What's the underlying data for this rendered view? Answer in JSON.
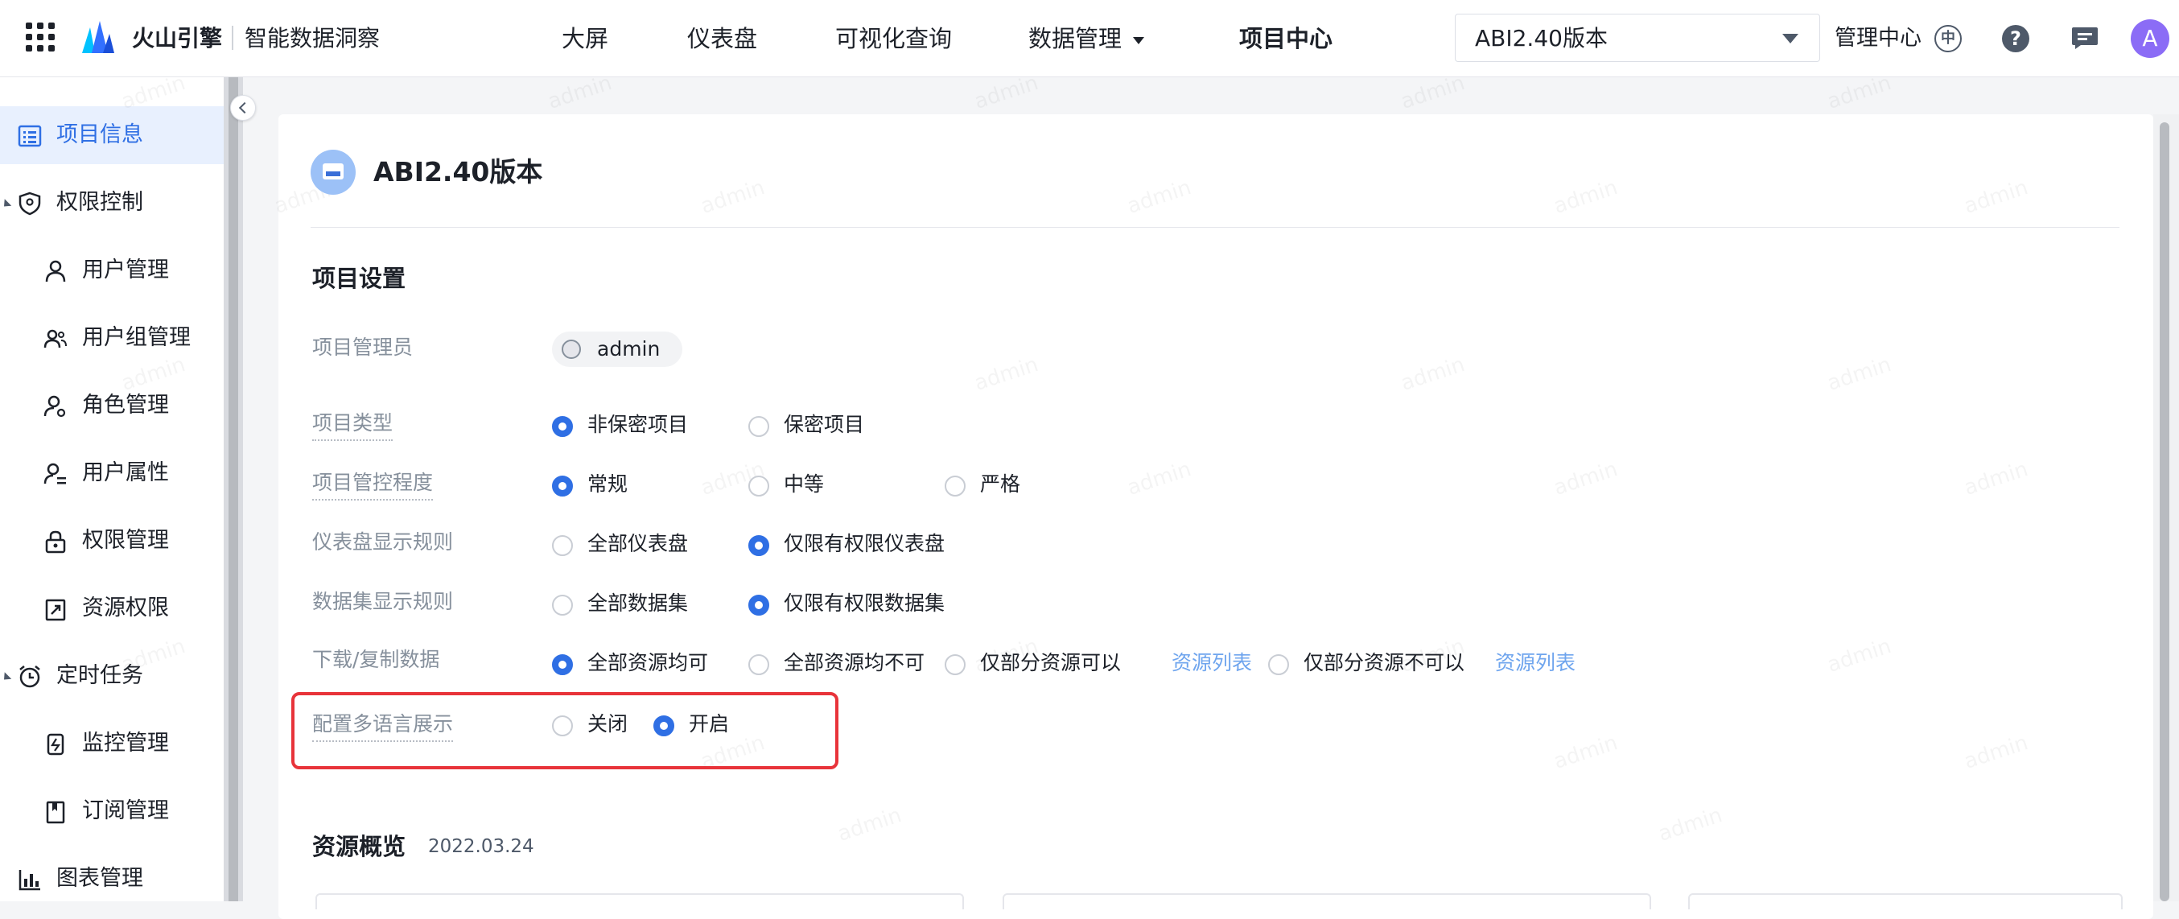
{
  "header": {
    "brand": "火山引擎",
    "product": "智能数据洞察",
    "nav": [
      "大屏",
      "仪表盘",
      "可视化查询",
      "数据管理",
      "项目中心"
    ],
    "project_select_value": "ABI2.40版本",
    "admin_center": "管理中心",
    "lang_glyph": "中",
    "help_glyph": "?",
    "avatar_letter": "A"
  },
  "sidebar": {
    "items": [
      {
        "label": "项目信息",
        "icon": "list-icon"
      },
      {
        "label": "权限控制",
        "icon": "shield-icon"
      },
      {
        "label": "用户管理",
        "icon": "user-icon"
      },
      {
        "label": "用户组管理",
        "icon": "users-icon"
      },
      {
        "label": "角色管理",
        "icon": "user-gear-icon"
      },
      {
        "label": "用户属性",
        "icon": "user-attr-icon"
      },
      {
        "label": "权限管理",
        "icon": "lock-icon"
      },
      {
        "label": "资源权限",
        "icon": "share-icon"
      },
      {
        "label": "定时任务",
        "icon": "alarm-icon"
      },
      {
        "label": "监控管理",
        "icon": "monitor-icon"
      },
      {
        "label": "订阅管理",
        "icon": "bookmark-icon"
      },
      {
        "label": "图表管理",
        "icon": "bar-chart-icon"
      }
    ]
  },
  "main": {
    "project_title": "ABI2.40版本",
    "settings_title": "项目设置",
    "admin_label": "项目管理员",
    "admin_name": "admin",
    "rows": {
      "type": {
        "label": "项目类型",
        "options": [
          "非保密项目",
          "保密项目"
        ]
      },
      "control": {
        "label": "项目管控程度",
        "options": [
          "常规",
          "中等",
          "严格"
        ]
      },
      "dashboard": {
        "label": "仪表盘显示规则",
        "options": [
          "全部仪表盘",
          "仅限有权限仪表盘"
        ]
      },
      "dataset": {
        "label": "数据集显示规则",
        "options": [
          "全部数据集",
          "仅限有权限数据集"
        ]
      },
      "download": {
        "label": "下载/复制数据",
        "options": [
          "全部资源均可",
          "全部资源均不可",
          "仅部分资源可以",
          "仅部分资源不可以"
        ],
        "link": "资源列表"
      },
      "multilang": {
        "label": "配置多语言展示",
        "options": [
          "关闭",
          "开启"
        ]
      }
    },
    "overview_title": "资源概览",
    "overview_date": "2022.03.24"
  },
  "watermark_text": "admin",
  "colors": {
    "accent": "#2f6fe4",
    "highlight": "#e8333a",
    "link": "#6fa5ee"
  }
}
